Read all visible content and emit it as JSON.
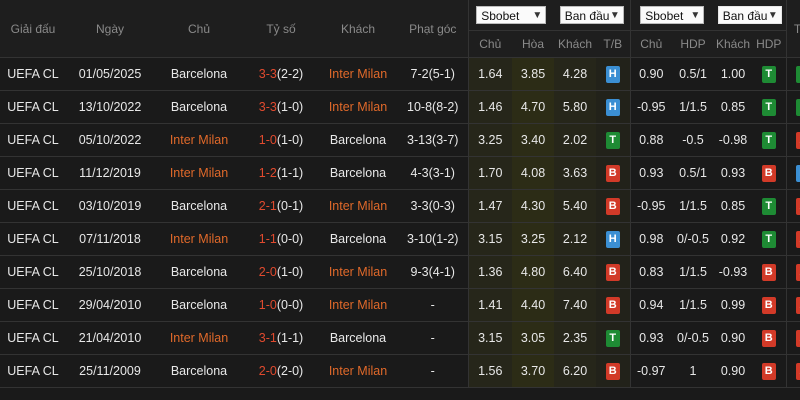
{
  "headers": {
    "league": "Giải đấu",
    "date": "Ngày",
    "home": "Chủ",
    "score": "Tỷ số",
    "away": "Khách",
    "corner": "Phạt góc",
    "tx": "T/X"
  },
  "selects": {
    "bookmaker1": "Sbobet",
    "type1": "Ban đầu",
    "bookmaker2": "Sbobet",
    "type2": "Ban đầu"
  },
  "subheaders": {
    "home": "Chủ",
    "draw": "Hòa",
    "away": "Khách",
    "tb": "T/B",
    "home2": "Chủ",
    "hdp": "HDP",
    "away2": "Khách",
    "hdp2": "HDP"
  },
  "rows": [
    {
      "league": "UEFA CL",
      "date": "01/05/2025",
      "home": "Barcelona",
      "home_color": "white",
      "score": "3-3",
      "ht": "(2-2)",
      "away": "Inter Milan",
      "away_color": "orange",
      "corner": "7-2(5-1)",
      "o1": "1.64",
      "o2": "3.85",
      "o3": "4.28",
      "tb": "H",
      "a1": "0.90",
      "a2": "0.5/1",
      "a3": "1.00",
      "hdp": "T",
      "tx": "T"
    },
    {
      "league": "UEFA CL",
      "date": "13/10/2022",
      "home": "Barcelona",
      "home_color": "white",
      "score": "3-3",
      "ht": "(1-0)",
      "away": "Inter Milan",
      "away_color": "orange",
      "corner": "10-8(8-2)",
      "o1": "1.46",
      "o2": "4.70",
      "o3": "5.80",
      "tb": "H",
      "a1": "-0.95",
      "a2": "1/1.5",
      "a3": "0.85",
      "hdp": "T",
      "tx": "T"
    },
    {
      "league": "UEFA CL",
      "date": "05/10/2022",
      "home": "Inter Milan",
      "home_color": "orange",
      "score": "1-0",
      "ht": "(1-0)",
      "away": "Barcelona",
      "away_color": "white",
      "corner": "3-13(3-7)",
      "o1": "3.25",
      "o2": "3.40",
      "o3": "2.02",
      "tb": "T",
      "a1": "0.88",
      "a2": "-0.5",
      "a3": "-0.98",
      "hdp": "T",
      "tx": "X"
    },
    {
      "league": "UEFA CL",
      "date": "11/12/2019",
      "home": "Inter Milan",
      "home_color": "orange",
      "score": "1-2",
      "ht": "(1-1)",
      "away": "Barcelona",
      "away_color": "white",
      "corner": "4-3(3-1)",
      "o1": "1.70",
      "o2": "4.08",
      "o3": "3.63",
      "tb": "B",
      "a1": "0.93",
      "a2": "0.5/1",
      "a3": "0.93",
      "hdp": "B",
      "tx": "H"
    },
    {
      "league": "UEFA CL",
      "date": "03/10/2019",
      "home": "Barcelona",
      "home_color": "white",
      "score": "2-1",
      "ht": "(0-1)",
      "away": "Inter Milan",
      "away_color": "orange",
      "corner": "3-3(0-3)",
      "o1": "1.47",
      "o2": "4.30",
      "o3": "5.40",
      "tb": "B",
      "a1": "-0.95",
      "a2": "1/1.5",
      "a3": "0.85",
      "hdp": "T",
      "tx": "X"
    },
    {
      "league": "UEFA CL",
      "date": "07/11/2018",
      "home": "Inter Milan",
      "home_color": "orange",
      "score": "1-1",
      "ht": "(0-0)",
      "away": "Barcelona",
      "away_color": "white",
      "corner": "3-10(1-2)",
      "o1": "3.15",
      "o2": "3.25",
      "o3": "2.12",
      "tb": "H",
      "a1": "0.98",
      "a2": "0/-0.5",
      "a3": "0.92",
      "hdp": "T",
      "tx": "X"
    },
    {
      "league": "UEFA CL",
      "date": "25/10/2018",
      "home": "Barcelona",
      "home_color": "white",
      "score": "2-0",
      "ht": "(1-0)",
      "away": "Inter Milan",
      "away_color": "orange",
      "corner": "9-3(4-1)",
      "o1": "1.36",
      "o2": "4.80",
      "o3": "6.40",
      "tb": "B",
      "a1": "0.83",
      "a2": "1/1.5",
      "a3": "-0.93",
      "hdp": "B",
      "tx": "X"
    },
    {
      "league": "UEFA CL",
      "date": "29/04/2010",
      "home": "Barcelona",
      "home_color": "white",
      "score": "1-0",
      "ht": "(0-0)",
      "away": "Inter Milan",
      "away_color": "orange",
      "corner": "-",
      "o1": "1.41",
      "o2": "4.40",
      "o3": "7.40",
      "tb": "B",
      "a1": "0.94",
      "a2": "1/1.5",
      "a3": "0.99",
      "hdp": "B",
      "tx": "X"
    },
    {
      "league": "UEFA CL",
      "date": "21/04/2010",
      "home": "Inter Milan",
      "home_color": "orange",
      "score": "3-1",
      "ht": "(1-1)",
      "away": "Barcelona",
      "away_color": "white",
      "corner": "-",
      "o1": "3.15",
      "o2": "3.05",
      "o3": "2.35",
      "tb": "T",
      "a1": "0.93",
      "a2": "0/-0.5",
      "a3": "0.90",
      "hdp": "B",
      "tx": "X"
    },
    {
      "league": "UEFA CL",
      "date": "25/11/2009",
      "home": "Barcelona",
      "home_color": "white",
      "score": "2-0",
      "ht": "(2-0)",
      "away": "Inter Milan",
      "away_color": "orange",
      "corner": "-",
      "o1": "1.56",
      "o2": "3.70",
      "o3": "6.20",
      "tb": "B",
      "a1": "-0.97",
      "a2": "1",
      "a3": "0.90",
      "hdp": "B",
      "tx": "X"
    }
  ],
  "colors": {
    "orange": "#e0692a",
    "score_red": "#e04a2e",
    "badge_H": "#3b8fd3",
    "badge_T": "#1e8b34",
    "badge_B": "#d23a28"
  }
}
